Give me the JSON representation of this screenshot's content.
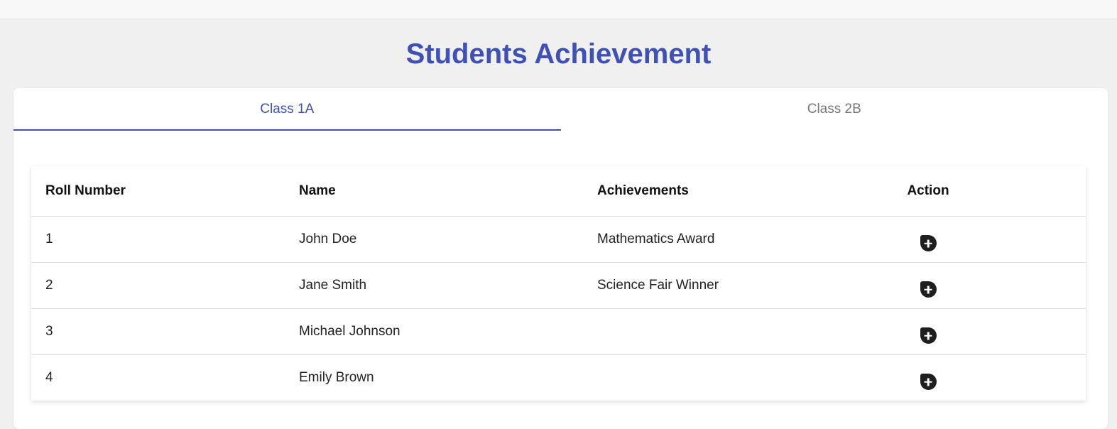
{
  "page": {
    "title": "Students Achievement",
    "accent_color": "#3f51b5"
  },
  "tabs": [
    {
      "label": "Class 1A",
      "active": true
    },
    {
      "label": "Class 2B",
      "active": false
    }
  ],
  "table": {
    "headers": {
      "roll": "Roll Number",
      "name": "Name",
      "achievements": "Achievements",
      "action": "Action"
    },
    "rows": [
      {
        "roll": "1",
        "name": "John Doe",
        "achievements": "Mathematics Award",
        "action_icon": "plus-circle-icon"
      },
      {
        "roll": "2",
        "name": "Jane Smith",
        "achievements": "Science Fair Winner",
        "action_icon": "plus-circle-icon"
      },
      {
        "roll": "3",
        "name": "Michael Johnson",
        "achievements": "",
        "action_icon": "plus-circle-icon"
      },
      {
        "roll": "4",
        "name": "Emily Brown",
        "achievements": "",
        "action_icon": "plus-circle-icon"
      }
    ]
  }
}
